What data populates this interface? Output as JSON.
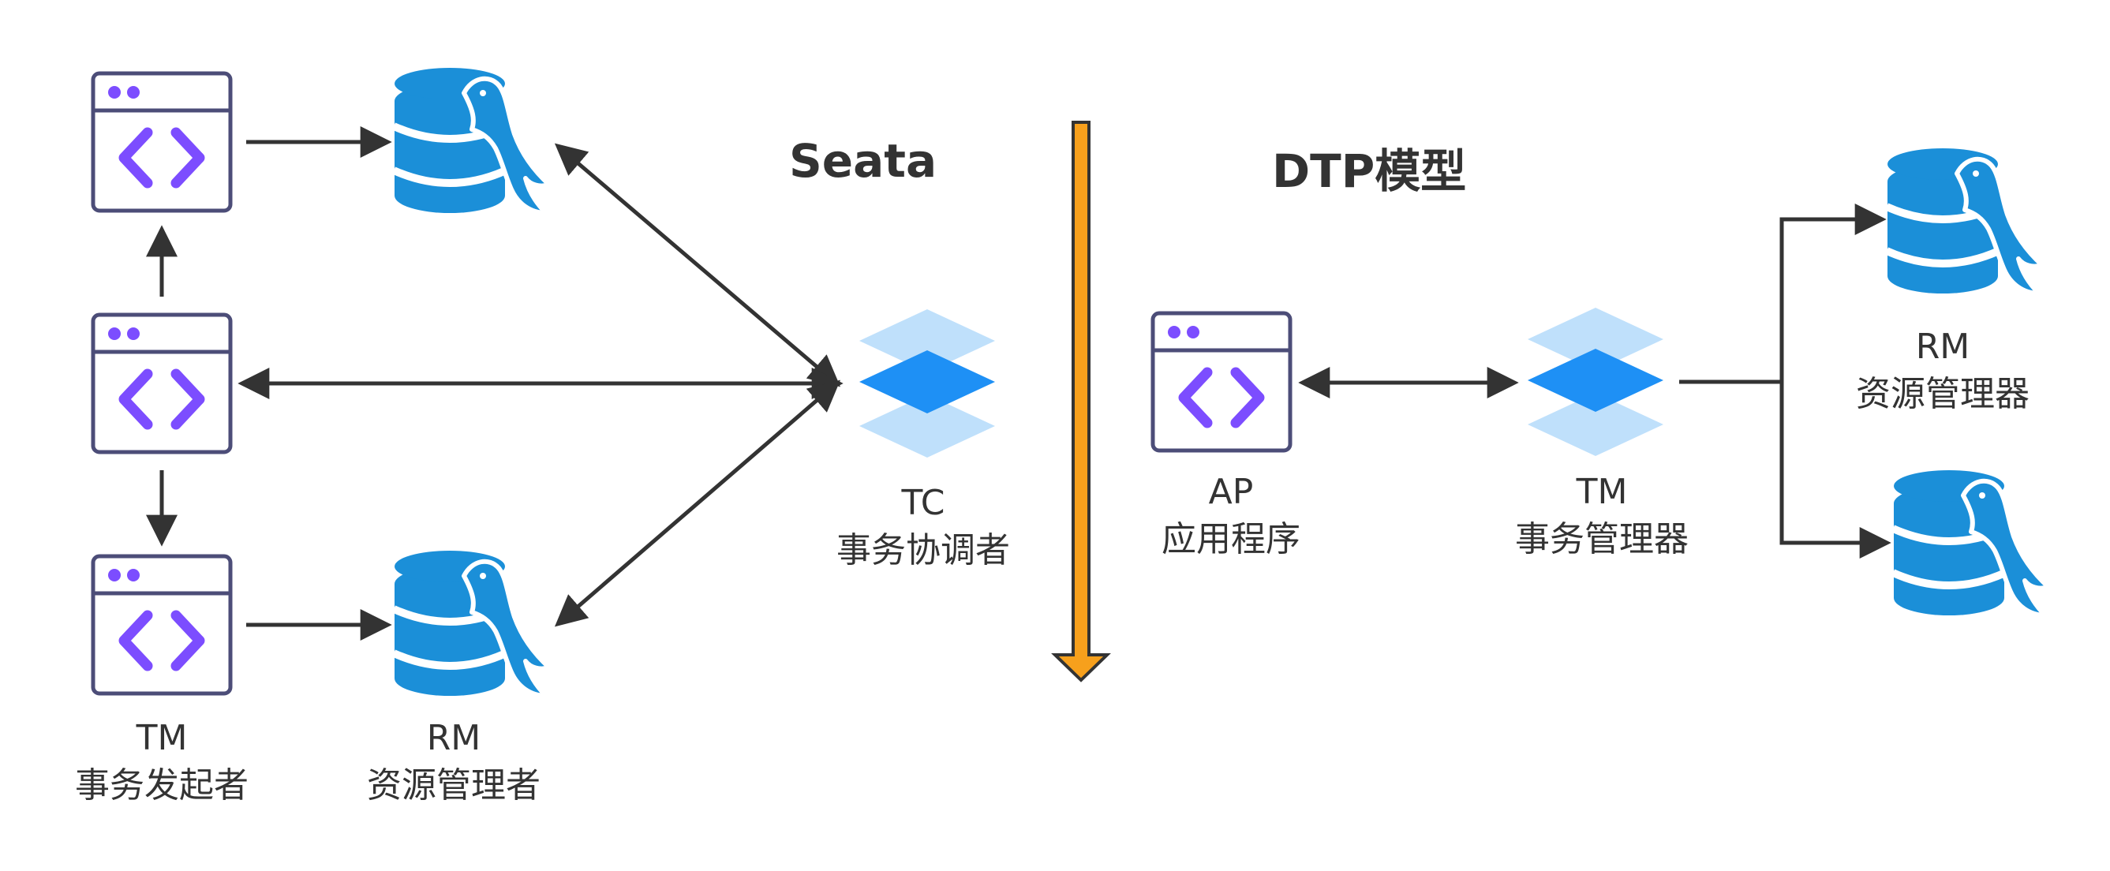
{
  "titles": {
    "seata": "Seata",
    "dtp": "DTP模型"
  },
  "seata": {
    "tm": {
      "abbr": "TM",
      "name": "事务发起者",
      "icon": "code-window-icon"
    },
    "rm": {
      "abbr": "RM",
      "name": "资源管理者",
      "icon": "mysql-database-icon"
    },
    "tc": {
      "abbr": "TC",
      "name": "事务协调者",
      "icon": "layers-stack-icon"
    }
  },
  "dtp": {
    "ap": {
      "abbr": "AP",
      "name": "应用程序",
      "icon": "code-window-icon"
    },
    "tm": {
      "abbr": "TM",
      "name": "事务管理器",
      "icon": "layers-stack-icon"
    },
    "rm": {
      "abbr": "RM",
      "name": "资源管理器",
      "icon": "mysql-database-icon"
    }
  },
  "colors": {
    "window_stroke": "#4c4d78",
    "window_accent": "#7c4dff",
    "db_blue": "#1b8fd8",
    "layer_light": "#bfe0fb",
    "layer_dark": "#1e90f5",
    "arrow": "#333333",
    "divider_fill": "#f7a01c"
  }
}
